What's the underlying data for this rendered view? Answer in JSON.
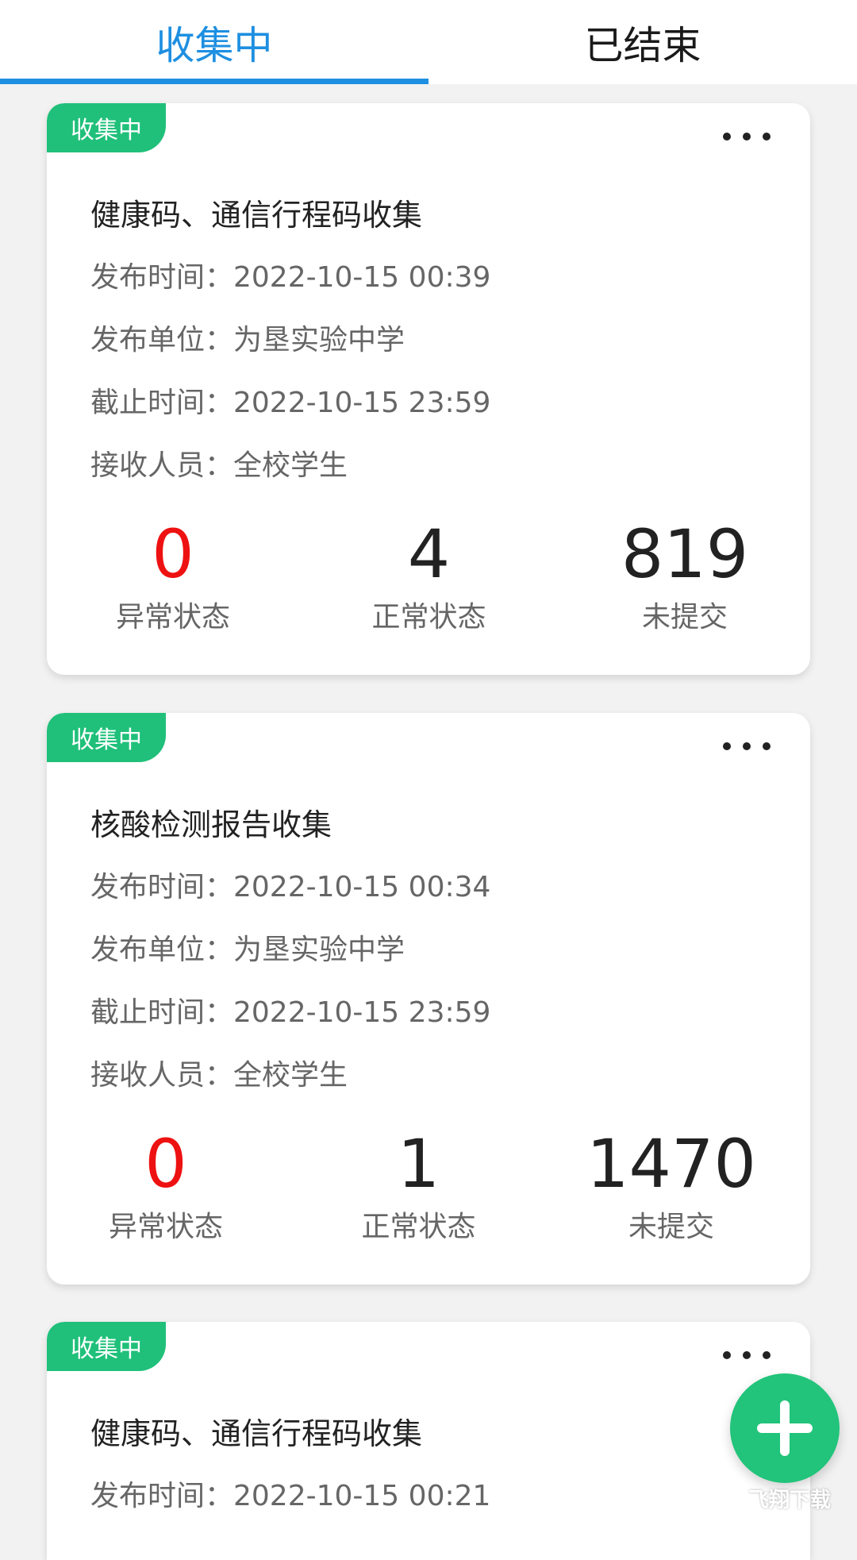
{
  "tabs": [
    {
      "label": "收集中",
      "active": true
    },
    {
      "label": "已结束",
      "active": false
    }
  ],
  "colors": {
    "accent": "#1e8fe1",
    "badge": "#20c07a",
    "abnormal": "#e11111",
    "fab": "#21c47a"
  },
  "cards": [
    {
      "badge": "收集中",
      "title": "健康码、通信行程码收集",
      "publish_time": "发布时间：2022-10-15 00:39",
      "publisher": "发布单位：为垦实验中学",
      "deadline": "截止时间：2022-10-15 23:59",
      "recipients": "接收人员：全校学生",
      "stats": {
        "abnormal": {
          "value": "0",
          "label": "异常状态"
        },
        "normal": {
          "value": "4",
          "label": "正常状态"
        },
        "unsubmitted": {
          "value": "819",
          "label": "未提交"
        }
      }
    },
    {
      "badge": "收集中",
      "title": "核酸检测报告收集",
      "publish_time": "发布时间：2022-10-15 00:34",
      "publisher": "发布单位：为垦实验中学",
      "deadline": "截止时间：2022-10-15 23:59",
      "recipients": "接收人员：全校学生",
      "stats": {
        "abnormal": {
          "value": "0",
          "label": "异常状态"
        },
        "normal": {
          "value": "1",
          "label": "正常状态"
        },
        "unsubmitted": {
          "value": "1470",
          "label": "未提交"
        }
      }
    },
    {
      "badge": "收集中",
      "title": "健康码、通信行程码收集",
      "publish_time": "发布时间：2022-10-15 00:21"
    }
  ],
  "fab": {
    "icon": "plus-icon"
  },
  "watermark": {
    "text": "飞翔下载"
  }
}
